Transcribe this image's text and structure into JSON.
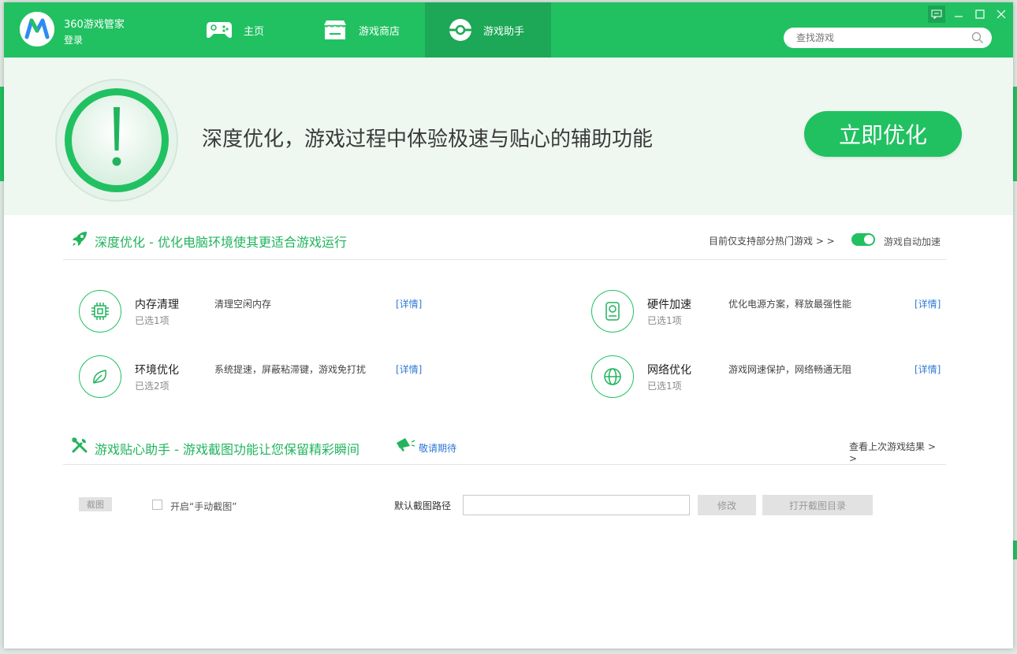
{
  "app": {
    "brand_name": "360游戏管家",
    "login_label": "登录",
    "brand_color": "#21c161"
  },
  "nav": {
    "tabs": [
      {
        "label": "主页",
        "icon": "gamepad-icon",
        "active": false
      },
      {
        "label": "游戏商店",
        "icon": "store-icon",
        "active": false
      },
      {
        "label": "游戏助手",
        "icon": "pokeball-icon",
        "active": true
      }
    ]
  },
  "search": {
    "placeholder": "查找游戏",
    "icon": "search-icon"
  },
  "window_controls": [
    "feedback-icon",
    "minimize-icon",
    "maximize-icon",
    "close-icon"
  ],
  "banner": {
    "icon": "exclamation-icon",
    "text": "深度优化，游戏过程中体验极速与贴心的辅助功能",
    "button_label": "立即优化"
  },
  "deep_opt": {
    "icon": "rocket-icon",
    "title": "深度优化 - 优化电脑环境使其更适合游戏运行",
    "support_link": "目前仅支持部分热门游戏 > >",
    "auto_accel_label": "游戏自动加速",
    "auto_accel_on": true,
    "items": [
      {
        "icon": "chip-icon",
        "name": "内存清理",
        "count": "已选1项",
        "desc": "清理空闲内存",
        "detail": "[详情]"
      },
      {
        "icon": "harddisk-icon",
        "name": "硬件加速",
        "count": "已选1项",
        "desc": "优化电源方案，释放最强性能",
        "detail": "[详情]"
      },
      {
        "icon": "leaf-icon",
        "name": "环境优化",
        "count": "已选2项",
        "desc": "系统提速，屏蔽粘滞键，游戏免打扰",
        "detail": "[详情]"
      },
      {
        "icon": "globe-icon",
        "name": "网络优化",
        "count": "已选1项",
        "desc": "游戏网速保护，网络畅通无阻",
        "detail": "[详情]"
      }
    ]
  },
  "assistant": {
    "icon": "tools-icon",
    "title": "游戏贴心助手 - 游戏截图功能让您保留精彩瞬间",
    "coming_icon": "megaphone-icon",
    "coming_label": "敬请期待",
    "last_result_link": "查看上次游戏结果 > >",
    "screenshot_btn": "截图",
    "manual_checkbox_label": "开启“手动截图”",
    "manual_checked": false,
    "path_label": "默认截图路径",
    "path_value": "",
    "modify_btn": "修改",
    "open_dir_btn": "打开截图目录"
  }
}
